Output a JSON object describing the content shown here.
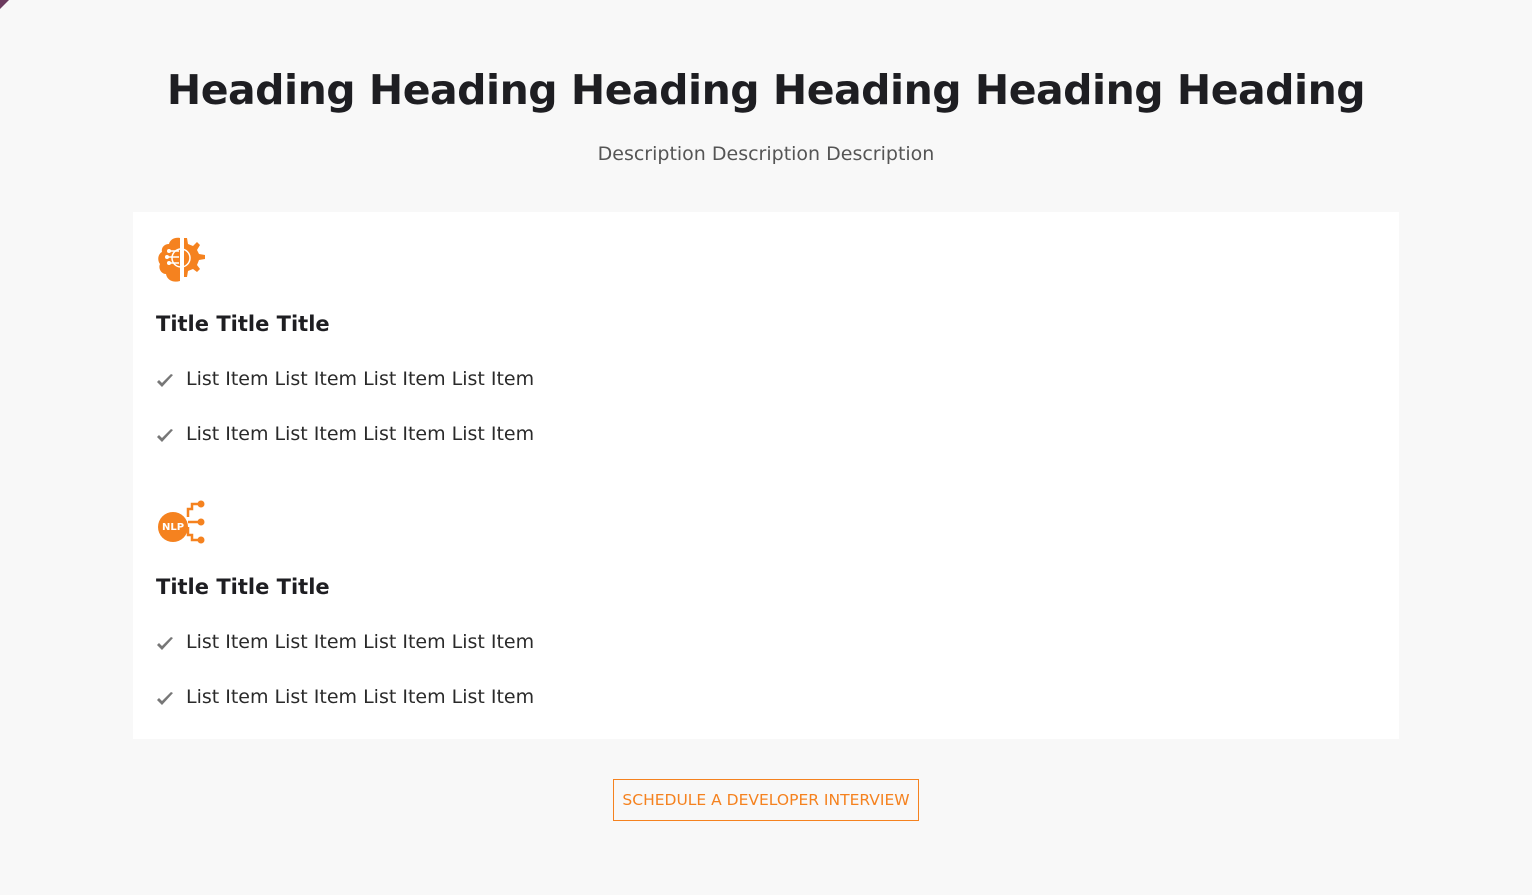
{
  "header": {
    "title": "Heading Heading Heading Heading Heading Heading",
    "description": "Description Description Description"
  },
  "sections": [
    {
      "icon": "ai-brain-gear-icon",
      "title": "Title Title Title",
      "items": [
        "List Item List Item List Item List Item",
        "List Item List Item List Item List Item"
      ]
    },
    {
      "icon": "nlp-icon",
      "icon_text": "NLP",
      "title": "Title Title Title",
      "items": [
        "List Item List Item List Item List Item",
        "List Item List Item List Item List Item"
      ]
    }
  ],
  "cta": {
    "label": "SCHEDULE A DEVELOPER INTERVIEW"
  },
  "colors": {
    "accent": "#f5821f",
    "text": "#1e1e22",
    "background": "#f8f8f8"
  }
}
